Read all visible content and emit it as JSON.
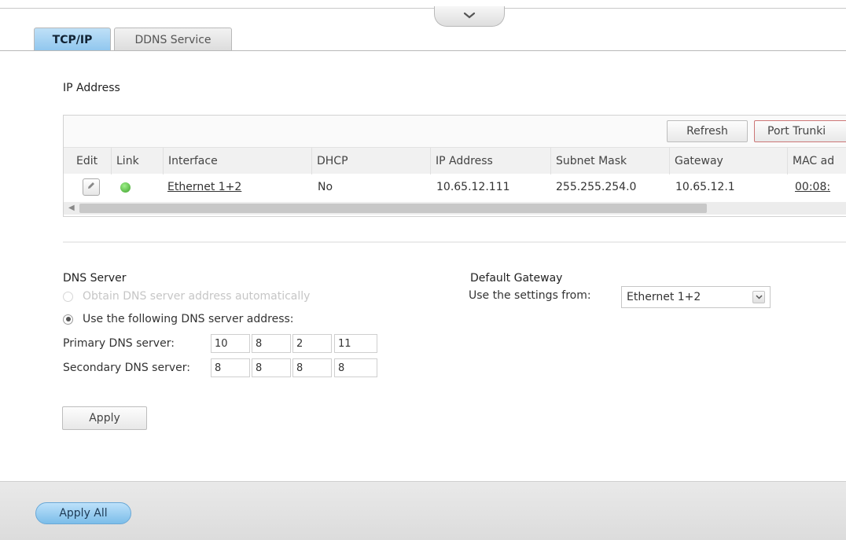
{
  "tabs": [
    {
      "label": "TCP/IP",
      "active": true
    },
    {
      "label": "DDNS Service",
      "active": false
    }
  ],
  "ip_section": {
    "title": "IP Address",
    "refresh_label": "Refresh",
    "port_trunking_label": "Port Trunki",
    "columns": [
      "Edit",
      "Link",
      "Interface",
      "DHCP",
      "IP Address",
      "Subnet Mask",
      "Gateway",
      "MAC ad"
    ],
    "rows": [
      {
        "link_status": "connected",
        "interface": "Ethernet 1+2",
        "dhcp": "No",
        "ip": "10.65.12.111",
        "subnet": "255.255.254.0",
        "gateway": "10.65.12.1",
        "mac": "00:08:"
      }
    ]
  },
  "dns": {
    "title": "DNS Server",
    "auto_label": "Obtain DNS server address automatically",
    "manual_label": "Use the following DNS server address:",
    "selected": "manual",
    "primary_label": "Primary DNS server:",
    "secondary_label": "Secondary DNS server:",
    "primary": [
      "10",
      "8",
      "2",
      "11"
    ],
    "secondary": [
      "8",
      "8",
      "8",
      "8"
    ],
    "apply_label": "Apply"
  },
  "gateway": {
    "title": "Default Gateway",
    "label": "Use the settings from:",
    "selected": "Ethernet 1+2"
  },
  "footer": {
    "apply_all_label": "Apply All"
  },
  "colors": {
    "accent": "#8fc6ee",
    "link_ok": "#3ea02b"
  },
  "icons": {
    "collapse": "chevron-down-icon",
    "edit": "edit-icon",
    "dropdown": "chevron-down-icon"
  }
}
